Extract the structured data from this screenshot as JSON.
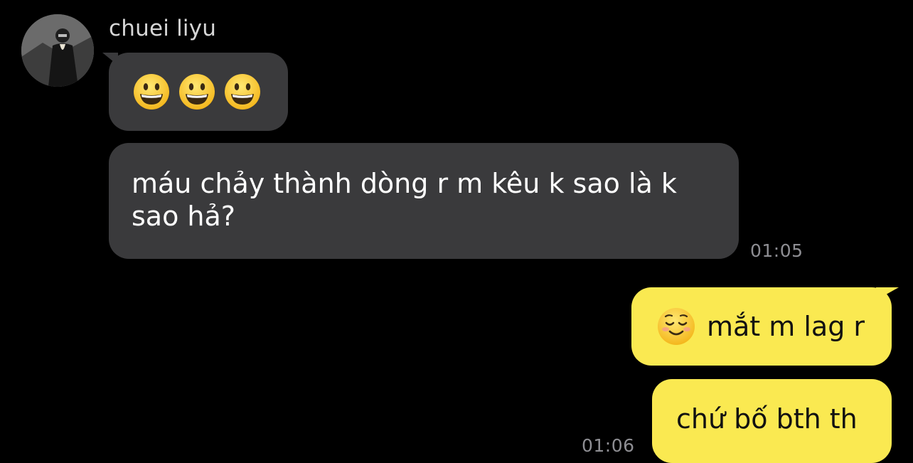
{
  "contact": {
    "name": "chuei liyu",
    "avatar_icon": "person-photo-avatar"
  },
  "messages": [
    {
      "direction": "incoming",
      "emoji": [
        "grinning-face-emoji",
        "grinning-face-emoji",
        "grinning-face-emoji"
      ],
      "text": ""
    },
    {
      "direction": "incoming",
      "text": "máu chảy thành dòng r m kêu k sao là k sao hả?",
      "time": "01:05"
    },
    {
      "direction": "outgoing",
      "emoji": [
        "smiling-face-emoji"
      ],
      "text": "mắt m lag r"
    },
    {
      "direction": "outgoing",
      "text": "chứ bố bth th",
      "time": "01:06"
    }
  ],
  "colors": {
    "background": "#000000",
    "incoming_bubble": "#3a3a3c",
    "outgoing_bubble": "#fae951",
    "timestamp": "#8e8e93",
    "name": "#d6d6d6"
  }
}
